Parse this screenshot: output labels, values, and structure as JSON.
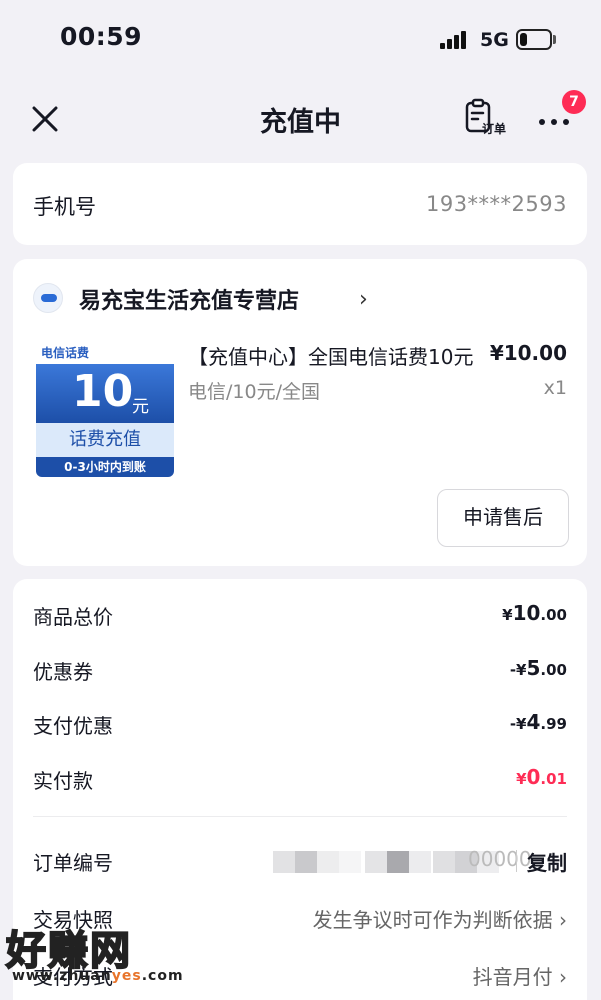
{
  "status_bar": {
    "time": "00:59",
    "network": "5G",
    "battery_level": 0.25
  },
  "nav": {
    "title": "充值中",
    "order_label": "订单",
    "badge_count": "7"
  },
  "phone": {
    "label": "手机号",
    "value": "193****2593"
  },
  "store": {
    "name": "易充宝生活充值专营店",
    "chevron": "›"
  },
  "product": {
    "thumb_top": "电信话费",
    "thumb_amount": "10",
    "thumb_unit": "元",
    "thumb_band": "话费充值",
    "thumb_foot": "0-3小时内到账",
    "title": "【充值中心】全国电信话费10元",
    "price": "¥10.00",
    "spec": "电信/10元/全国",
    "quantity": "x1"
  },
  "aftersale_button": "申请售后",
  "summary": {
    "total": {
      "label": "商品总价",
      "prefix": "¥",
      "main": "10",
      "decimal": ".00"
    },
    "coupon": {
      "label": "优惠券",
      "prefix": "-¥",
      "main": "5",
      "decimal": ".00"
    },
    "pay_discount": {
      "label": "支付优惠",
      "prefix": "-¥",
      "main": "4",
      "decimal": ".99"
    },
    "paid": {
      "label": "实付款",
      "prefix": "¥",
      "main": "0",
      "decimal": ".01"
    }
  },
  "order_no": {
    "label": "订单编号",
    "value_visible": "00000",
    "copy_label": "复制"
  },
  "snapshot": {
    "label": "交易快照",
    "value": "发生争议时可作为判断依据 ›"
  },
  "pay_method": {
    "label": "支付方式",
    "value": "抖音月付 ›"
  },
  "watermark": {
    "main": "好赚网",
    "url_pre": "www.zhuan",
    "url_mid": "yes",
    "url_post": ".com"
  },
  "colors": {
    "accent_red": "#fe2c55",
    "background": "#f2f1f6"
  }
}
